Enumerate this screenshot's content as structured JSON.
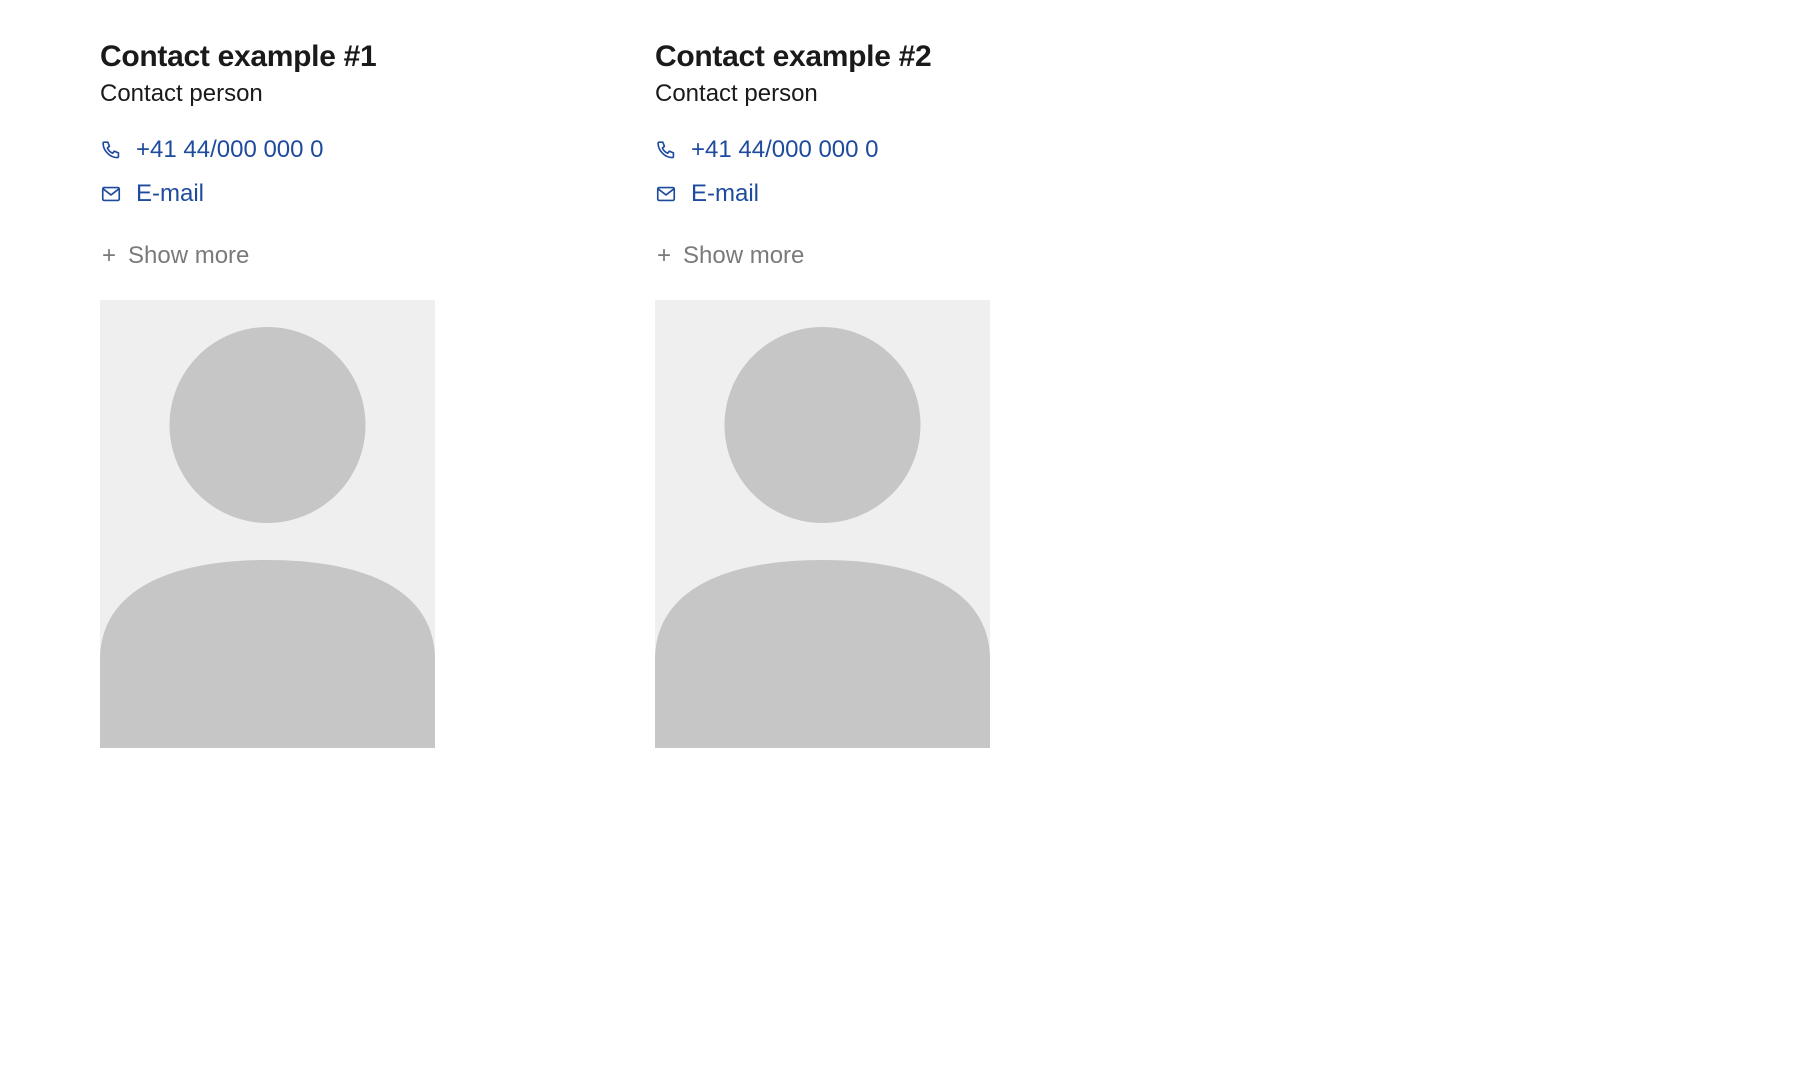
{
  "contacts": [
    {
      "name": "Contact example #1",
      "role": "Contact person",
      "phone": "+41 44/000 000 0",
      "email_label": "E-mail",
      "show_more_label": "Show more"
    },
    {
      "name": "Contact example #2",
      "role": "Contact person",
      "phone": "+41 44/000 000 0",
      "email_label": "E-mail",
      "show_more_label": "Show more"
    }
  ]
}
